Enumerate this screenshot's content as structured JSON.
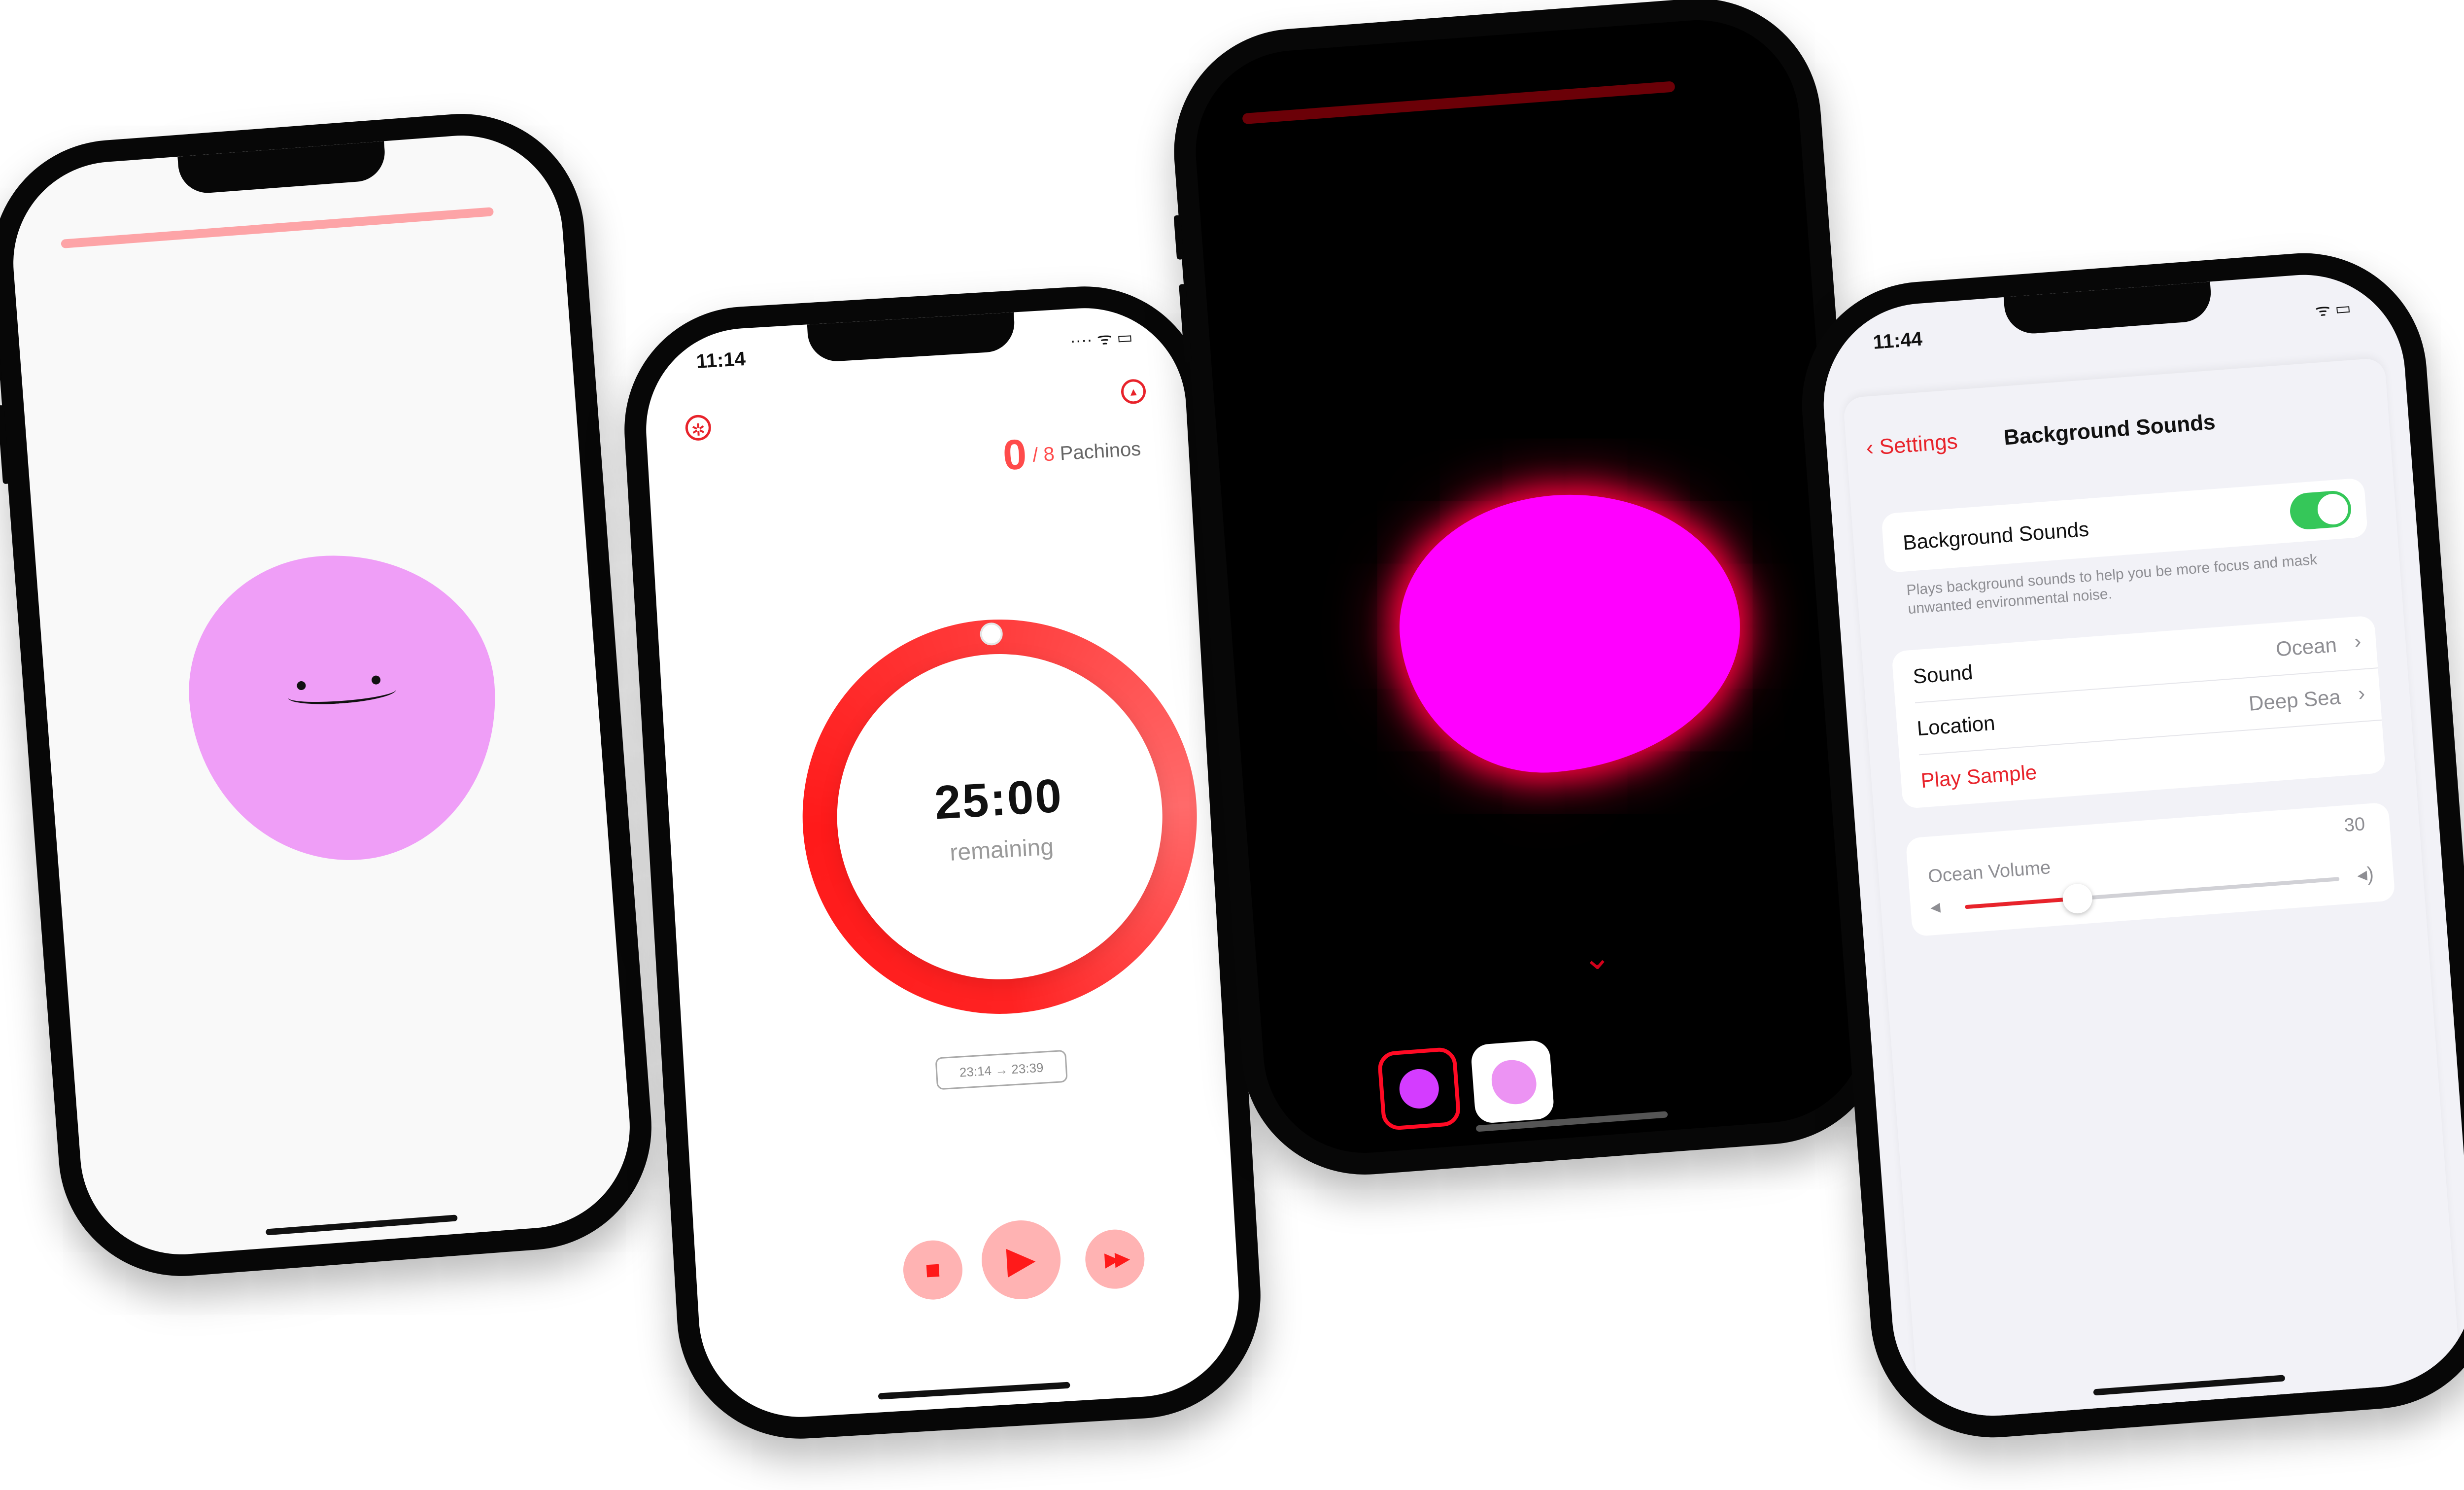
{
  "phone_face": {
    "colors": {
      "screen": "#f9f9f9",
      "progress": "#fda4a7",
      "blob": "#ef9ef7"
    }
  },
  "phone_timer": {
    "status": {
      "time": "11:14",
      "icons": "···· ᯤ ▭"
    },
    "counter": {
      "done": "0",
      "separator": "/",
      "goal": "8",
      "unit": "Pachinos"
    },
    "timer": {
      "time": "25:00",
      "label": "remaining",
      "progress": 0.0
    },
    "range": {
      "start": "23:14",
      "arrow": "→",
      "end": "23:39"
    },
    "controls": {
      "stop": "■",
      "play": "▶",
      "skip": "▶▶"
    },
    "icons": {
      "settings": "gear-icon",
      "up": "triangle-up-icon"
    }
  },
  "phone_dark": {
    "colors": {
      "progress": "#6b0007",
      "blob": "#ff00ff",
      "glow": "#ff0040"
    },
    "chevron": "⌄"
  },
  "phone_settings": {
    "status": {
      "time": "11:44",
      "icons": "ᯤ ▭"
    },
    "nav": {
      "back": "Settings",
      "title": "Background Sounds"
    },
    "toggle_row": {
      "label": "Background Sounds",
      "on": true
    },
    "footnote": "Plays background sounds to help you be more focus and mask unwanted environmental noise.",
    "sound_row": {
      "label": "Sound",
      "value": "Ocean"
    },
    "location_row": {
      "label": "Location",
      "value": "Deep Sea"
    },
    "play_sample": "Play Sample",
    "volume": {
      "label": "Ocean Volume",
      "value": "30",
      "level": 0.3
    }
  }
}
